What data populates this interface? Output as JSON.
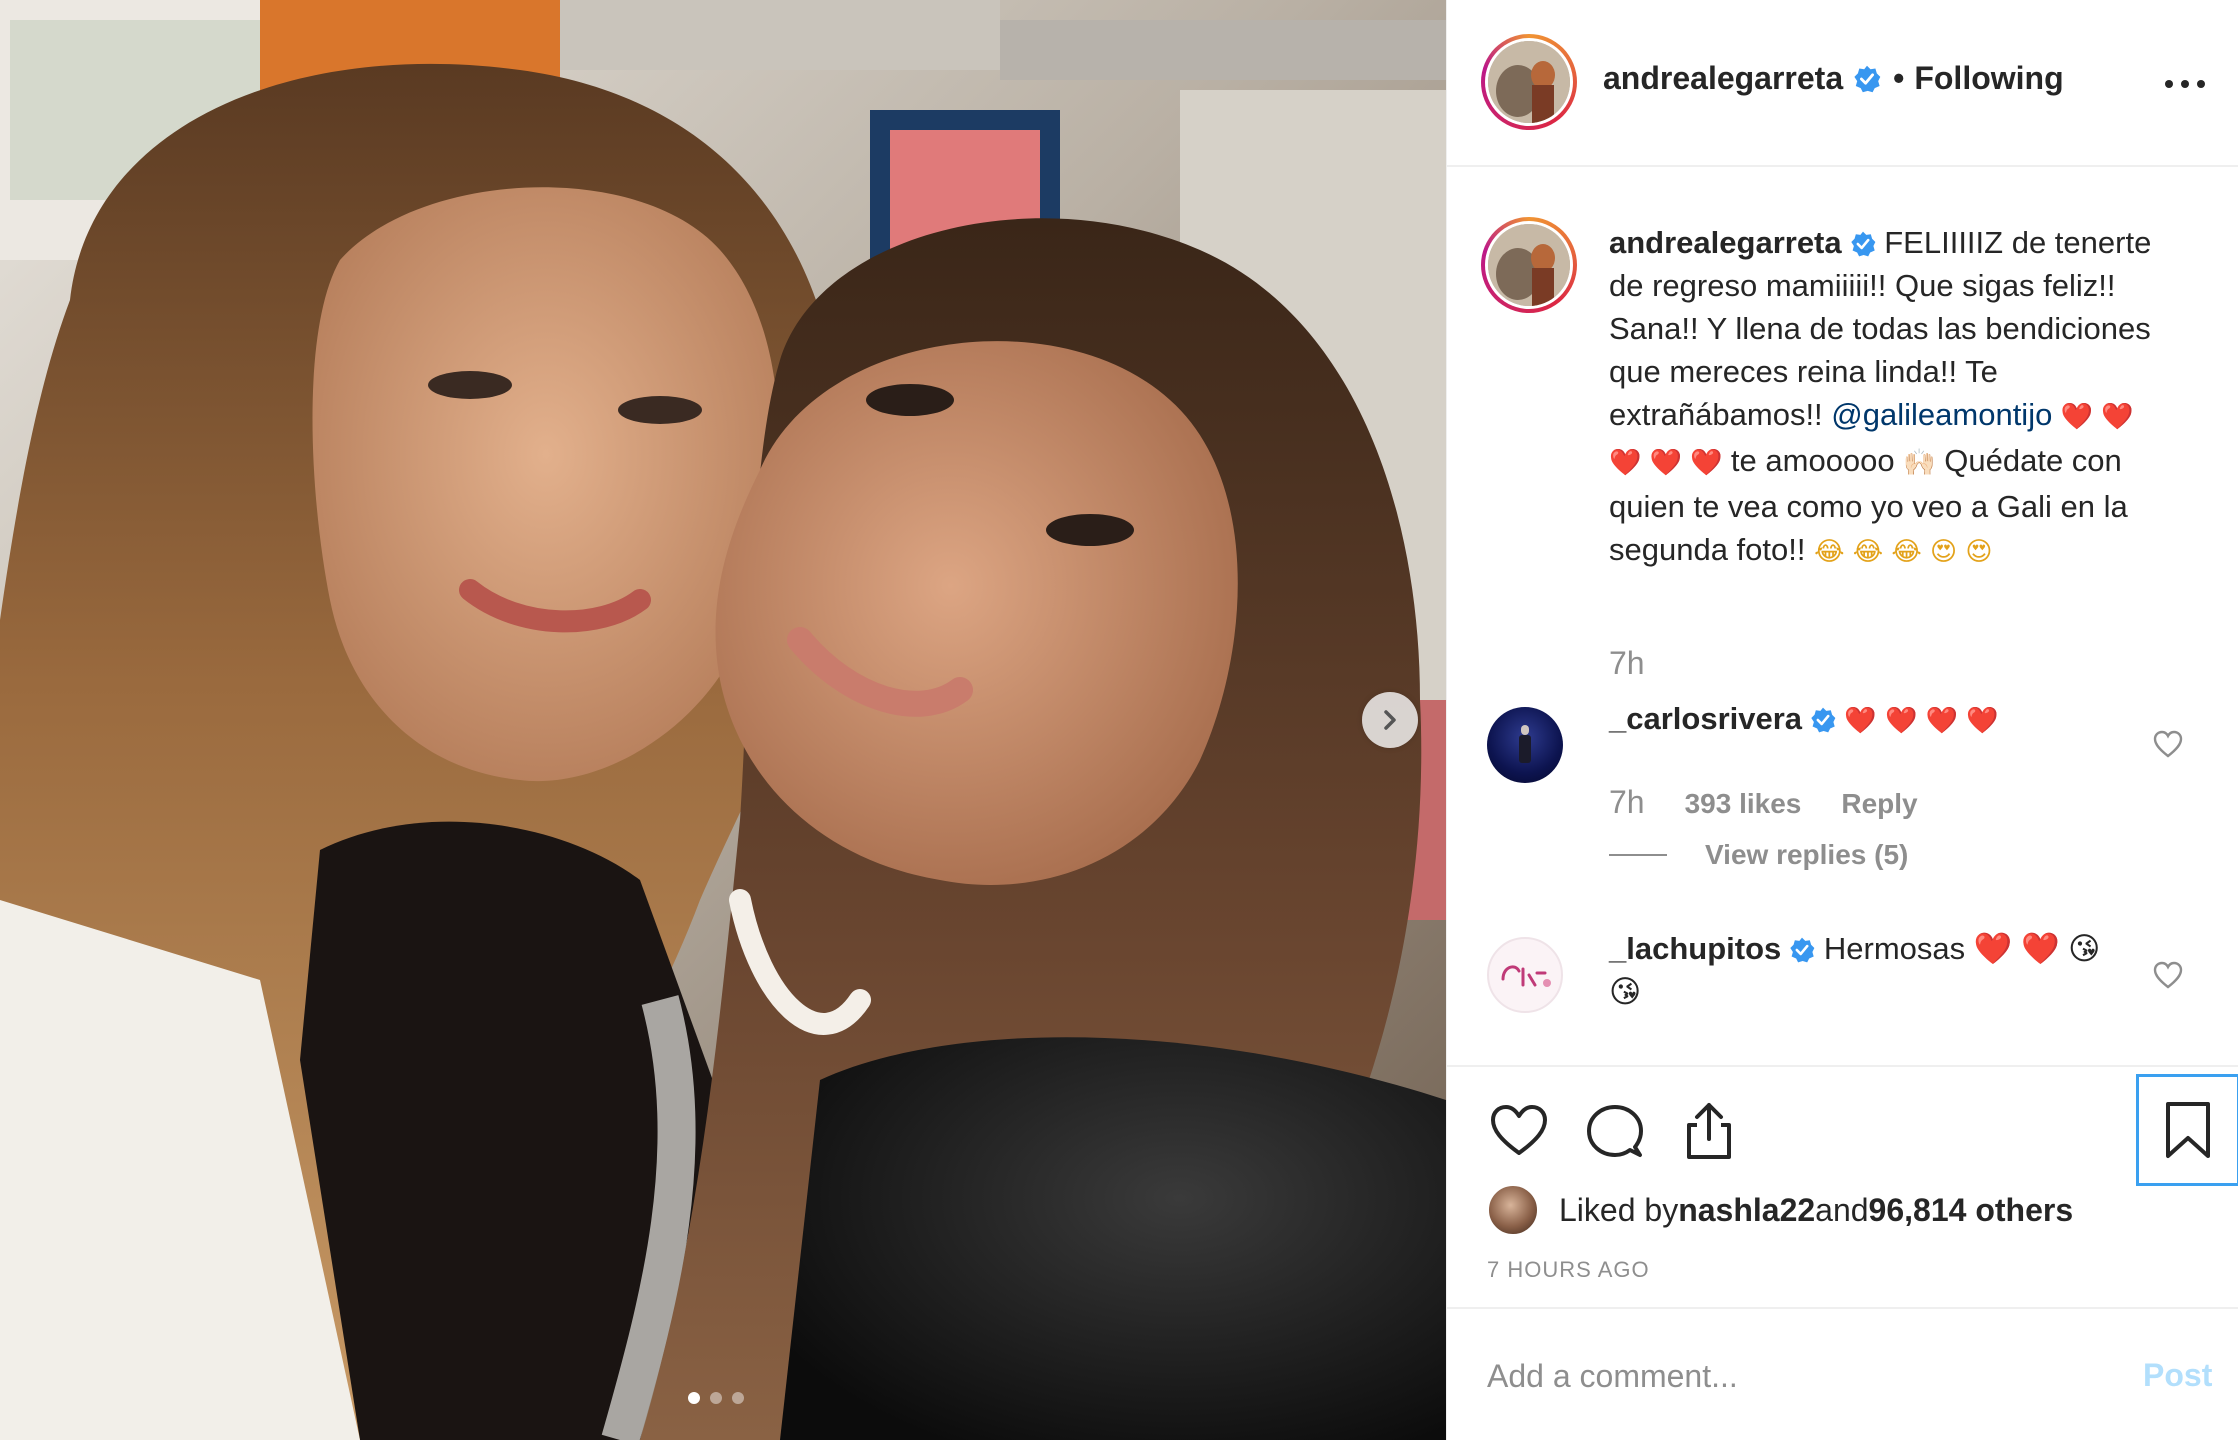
{
  "post": {
    "username": "andrealegarreta",
    "follow_status": "Following",
    "separator": "•",
    "carousel_active_index": 0,
    "carousel_count": 3
  },
  "caption": {
    "username": "andrealegarreta",
    "text_part1": " FELIIIIIZ de tenerte de regreso mamiiiii!! Que sigas feliz!! Sana!! Y llena de todas las bendiciones que mereces reina linda!! Te extrañábamos!! ",
    "mention": "@galileamontijo",
    "hearts": " ❤️ ❤️ ❤️ ❤️ ❤️ ",
    "text_part2": " te amooooo ",
    "hands_emoji": "🙌🏻",
    "text_part3": "  Quédate con quien te vea como yo veo a Gali en la segunda foto!! ",
    "end_emojis": "😂 😂 😂 😍 😍",
    "time": "7h"
  },
  "comments": [
    {
      "username": "_carlosrivera",
      "text": " ❤️ ❤️ ❤️ ❤️",
      "time": "7h",
      "likes": "393 likes",
      "reply_label": "Reply",
      "view_replies": "View replies (5)"
    },
    {
      "username": "_lachupitos",
      "text": " Hermosas ❤️ ❤️ 😘 😘"
    }
  ],
  "likes": {
    "prefix": "Liked by ",
    "user": "nashla22",
    "middle": " and ",
    "others": "96,814 others"
  },
  "timestamp": "7 HOURS AGO",
  "add_comment": {
    "placeholder": "Add a comment...",
    "post_label": "Post"
  },
  "colors": {
    "text": "#262626",
    "secondary": "#8e8e8e",
    "mention": "#00376b",
    "verified": "#3897f0",
    "post_disabled": "#b2dffc",
    "save_highlight": "#3aa0f0"
  },
  "icons": [
    "verified-badge-icon",
    "more-options-icon",
    "heart-icon",
    "comment-icon",
    "share-icon",
    "bookmark-icon",
    "chevron-right-icon"
  ]
}
